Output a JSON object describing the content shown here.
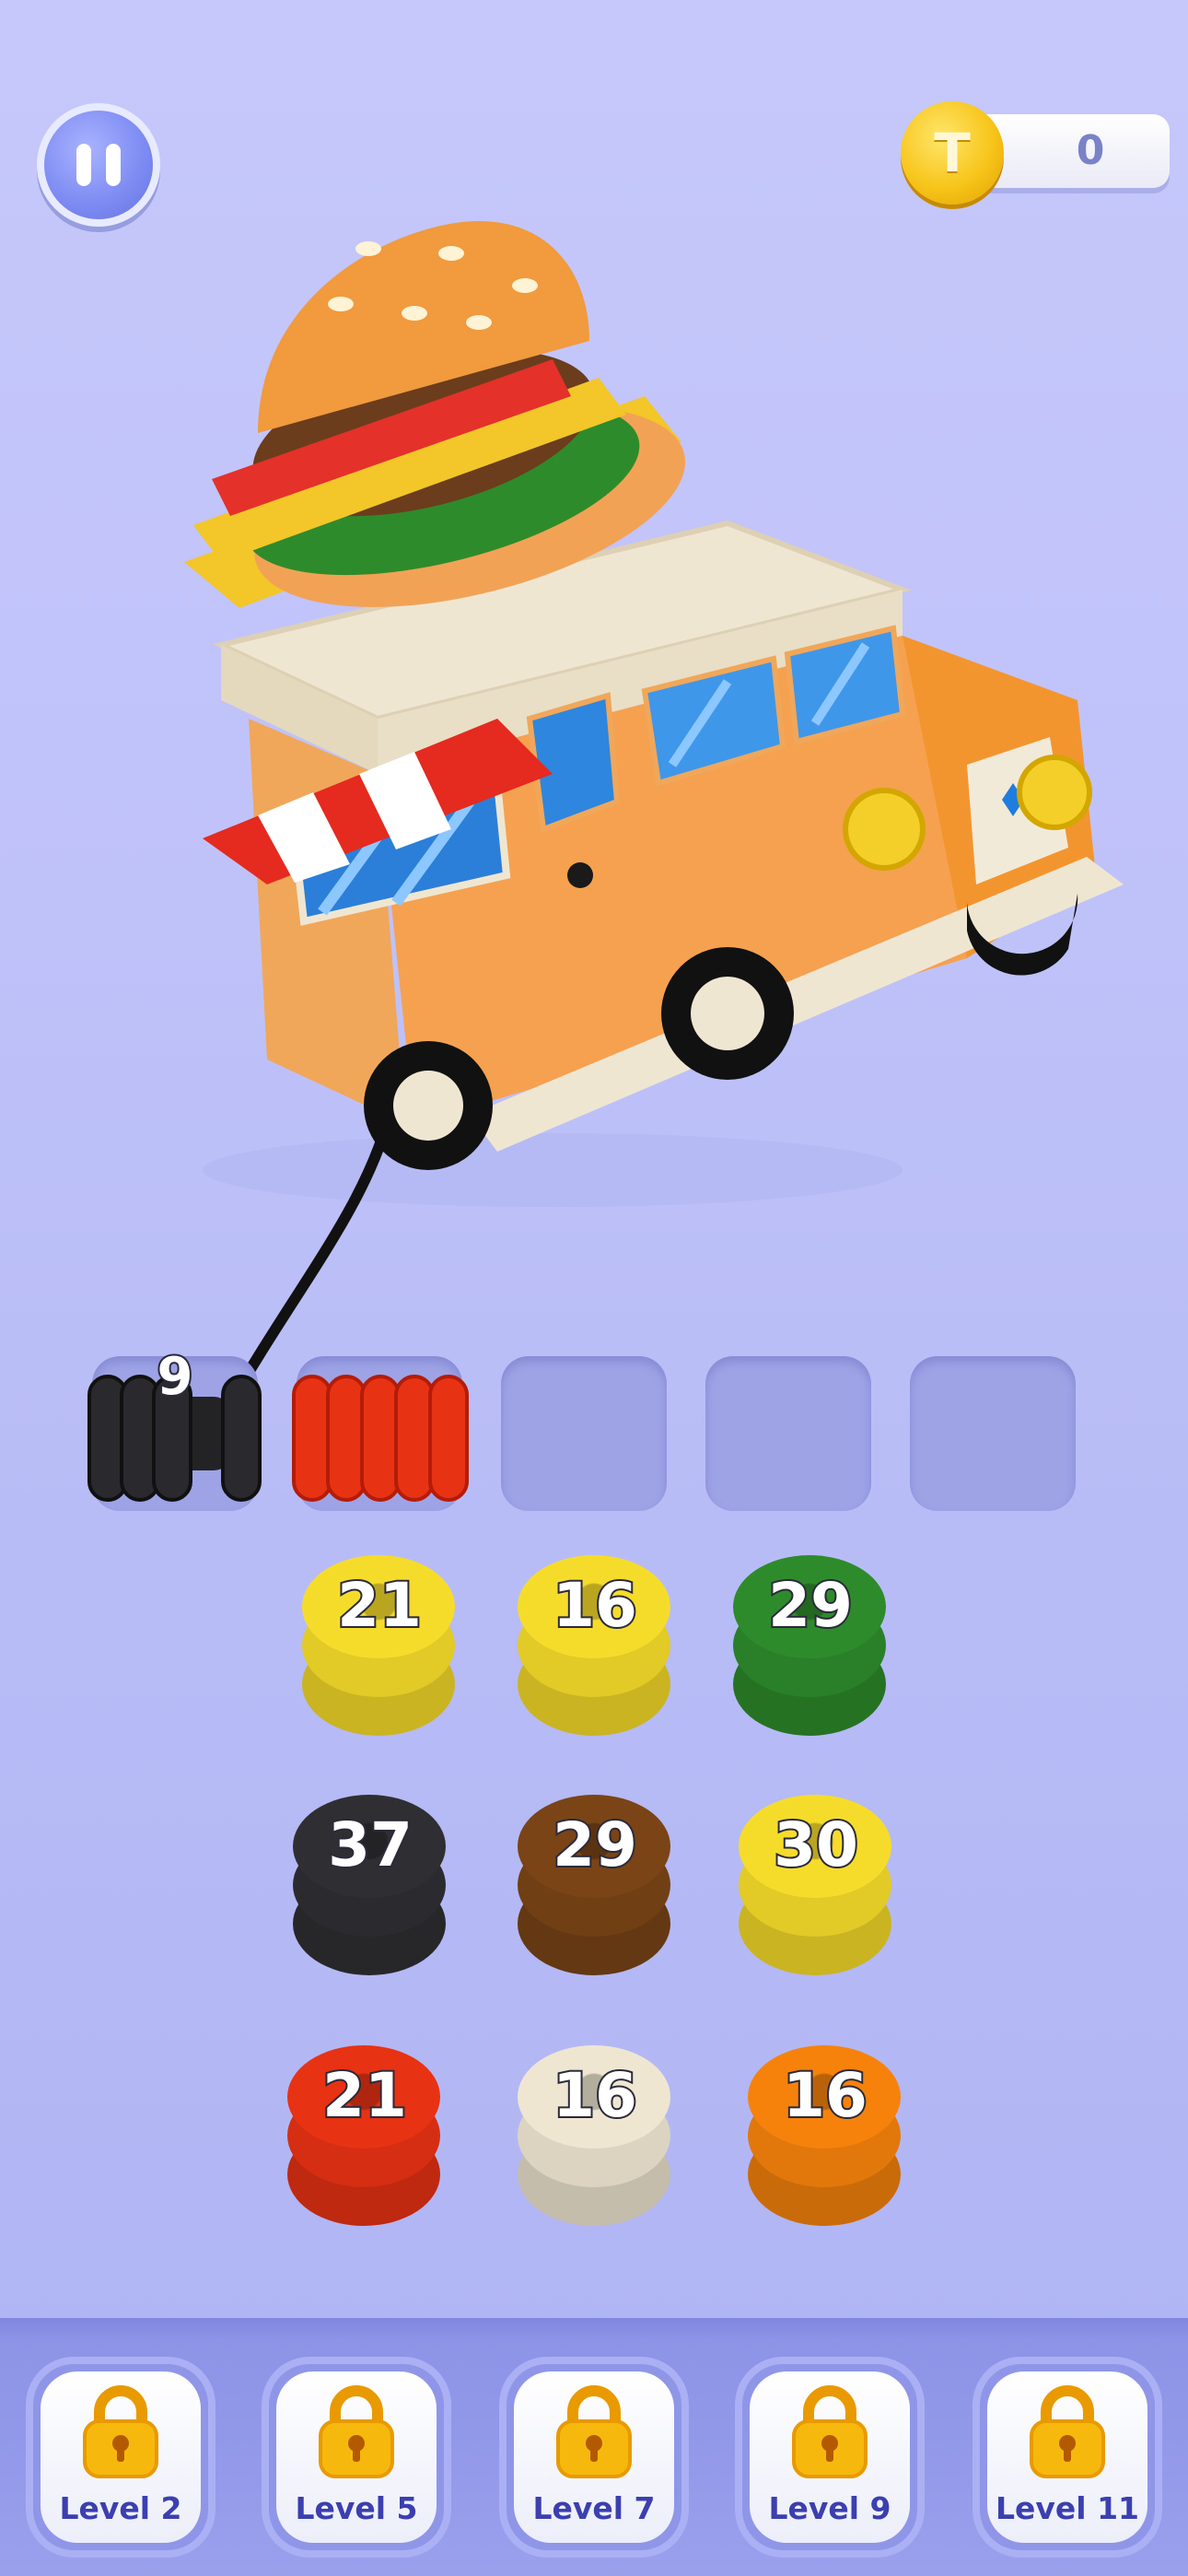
{
  "hud": {
    "coins": "0",
    "coin_symbol": "T"
  },
  "slots": [
    {
      "state": "filled",
      "color": "black",
      "count": "9"
    },
    {
      "state": "filled",
      "color": "red",
      "count": ""
    },
    {
      "state": "empty"
    },
    {
      "state": "empty"
    },
    {
      "state": "empty"
    }
  ],
  "spools": [
    {
      "count": "21",
      "color": "yellow"
    },
    {
      "count": "16",
      "color": "yellow"
    },
    {
      "count": "29",
      "color": "green"
    },
    {
      "count": "37",
      "color": "black"
    },
    {
      "count": "29",
      "color": "brown"
    },
    {
      "count": "30",
      "color": "yellow"
    },
    {
      "count": "21",
      "color": "red"
    },
    {
      "count": "16",
      "color": "cream"
    },
    {
      "count": "16",
      "color": "orange"
    }
  ],
  "levels": [
    {
      "label": "Level 2",
      "locked": true
    },
    {
      "label": "Level 5",
      "locked": true
    },
    {
      "label": "Level 7",
      "locked": true
    },
    {
      "label": "Level 9",
      "locked": true
    },
    {
      "label": "Level 11",
      "locked": true
    }
  ],
  "colors": {
    "yellow": "#f6dc2a",
    "green": "#2e8b2b",
    "black": "#2f2f33",
    "brown": "#7a4416",
    "red": "#e83214",
    "cream": "#efe6d2",
    "orange": "#f6820c",
    "accent": "#3b3fb0"
  }
}
